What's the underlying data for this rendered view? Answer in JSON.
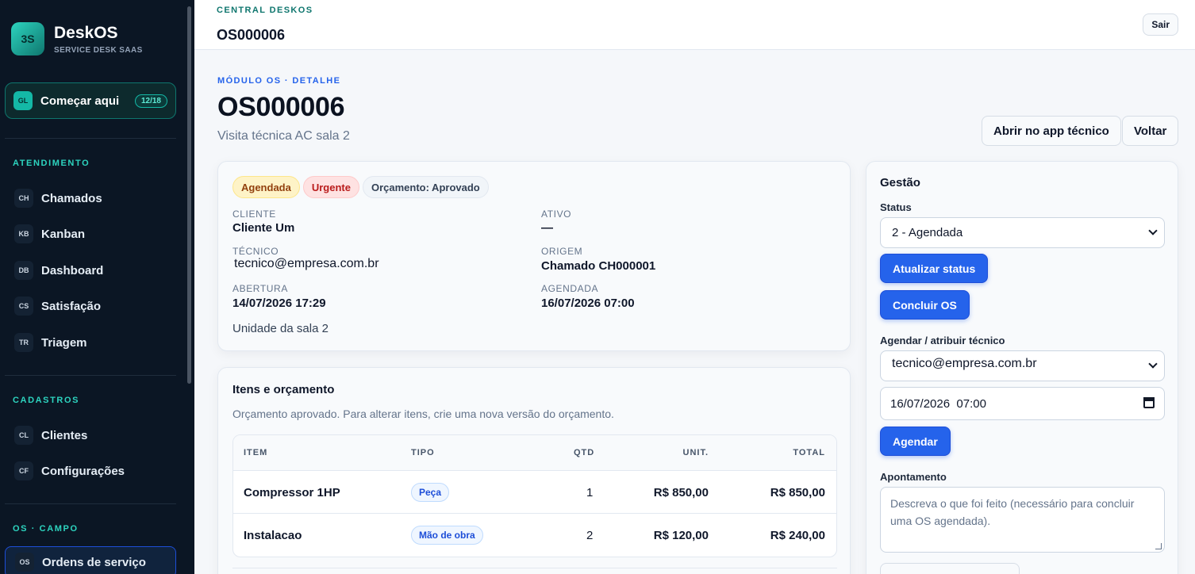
{
  "sidebar": {
    "brand": {
      "logo": "3S",
      "title": "DeskOS",
      "subtitle": "SERVICE DESK SAAS"
    },
    "start": {
      "icon": "GL",
      "label": "Começar aqui",
      "progress": "12/18"
    },
    "sections": [
      {
        "title": "ATENDIMENTO",
        "items": [
          {
            "icon": "CH",
            "label": "Chamados"
          },
          {
            "icon": "KB",
            "label": "Kanban"
          },
          {
            "icon": "DB",
            "label": "Dashboard"
          },
          {
            "icon": "CS",
            "label": "Satisfação"
          },
          {
            "icon": "TR",
            "label": "Triagem"
          }
        ]
      },
      {
        "title": "CADASTROS",
        "items": [
          {
            "icon": "CL",
            "label": "Clientes"
          },
          {
            "icon": "CF",
            "label": "Configurações"
          }
        ]
      },
      {
        "title": "OS · CAMPO",
        "items": [
          {
            "icon": "OS",
            "label": "Ordens de serviço",
            "active": true
          }
        ]
      }
    ]
  },
  "topbar": {
    "kicker": "CENTRAL DESKOS",
    "title": "OS000006",
    "logout_label": "Sair"
  },
  "header": {
    "kicker": "MÓDULO OS · DETALHE",
    "title": "OS000006",
    "subtitle": "Visita técnica AC sala 2",
    "open_app_label": "Abrir no app técnico",
    "back_label": "Voltar"
  },
  "summary": {
    "badges": {
      "status": "Agendada",
      "priority": "Urgente",
      "budget": "Orçamento: Aprovado"
    },
    "fields": {
      "cliente_label": "CLIENTE",
      "cliente_value": "Cliente Um",
      "ativo_label": "ATIVO",
      "ativo_value": "—",
      "tecnico_label": "TÉCNICO",
      "tecnico_value": "tecnico@empresa.com.br",
      "origem_label": "ORIGEM",
      "origem_value": "Chamado CH000001",
      "abertura_label": "ABERTURA",
      "abertura_value": "14/07/2026 17:29",
      "agendada_label": "AGENDADA",
      "agendada_value": "16/07/2026 07:00"
    },
    "location": "Unidade da sala 2"
  },
  "items": {
    "title": "Itens e orçamento",
    "note": "Orçamento aprovado. Para alterar itens, crie uma nova versão do orçamento.",
    "columns": {
      "item": "ITEM",
      "tipo": "TIPO",
      "qtd": "QTD",
      "unit": "UNIT.",
      "total": "TOTAL"
    },
    "rows": [
      {
        "item": "Compressor 1HP",
        "tipo": "Peça",
        "qtd": "1",
        "unit": "R$ 850,00",
        "total": "R$ 850,00"
      },
      {
        "item": "Instalacao",
        "tipo": "Mão de obra",
        "qtd": "2",
        "unit": "R$ 120,00",
        "total": "R$ 240,00"
      }
    ]
  },
  "gestao": {
    "title": "Gestão",
    "status_label": "Status",
    "status_value": "2 - Agendada",
    "update_status_label": "Atualizar status",
    "conclude_label": "Concluir OS",
    "schedule_label": "Agendar / atribuir técnico",
    "technician_value": "tecnico@empresa.com.br",
    "datetime_value": "16/07/2026  07:00",
    "schedule_button_label": "Agendar",
    "note_label": "Apontamento",
    "note_placeholder": "Descreva o que foi feito (necessário para concluir uma OS agendada)."
  }
}
